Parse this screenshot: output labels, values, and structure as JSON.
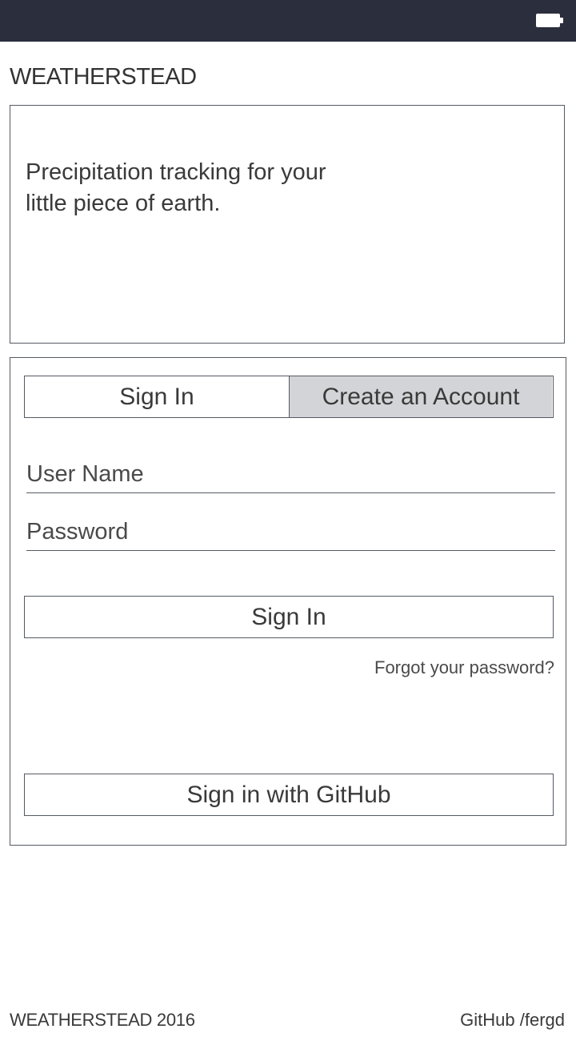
{
  "status_bar": {
    "icon": "battery-icon",
    "background_color": "#2b2e3d"
  },
  "brand": {
    "name": "WEATHERSTEAD"
  },
  "hero": {
    "tagline_line1": "Precipitation tracking for your",
    "tagline_line2": "little piece of earth."
  },
  "auth": {
    "tabs": [
      {
        "label": "Sign In",
        "active": true
      },
      {
        "label": "Create an Account",
        "active": false
      }
    ],
    "username_placeholder": "User Name",
    "password_placeholder": "Password",
    "signin_button": "Sign In",
    "forgot_link": "Forgot your password?",
    "github_button": "Sign in with GitHub"
  },
  "footer": {
    "copyright": "WEATHERSTEAD 2016",
    "github_link": "GitHub /fergd"
  },
  "colors": {
    "border": "#555a63",
    "inactive_tab": "#d3d4d7"
  }
}
